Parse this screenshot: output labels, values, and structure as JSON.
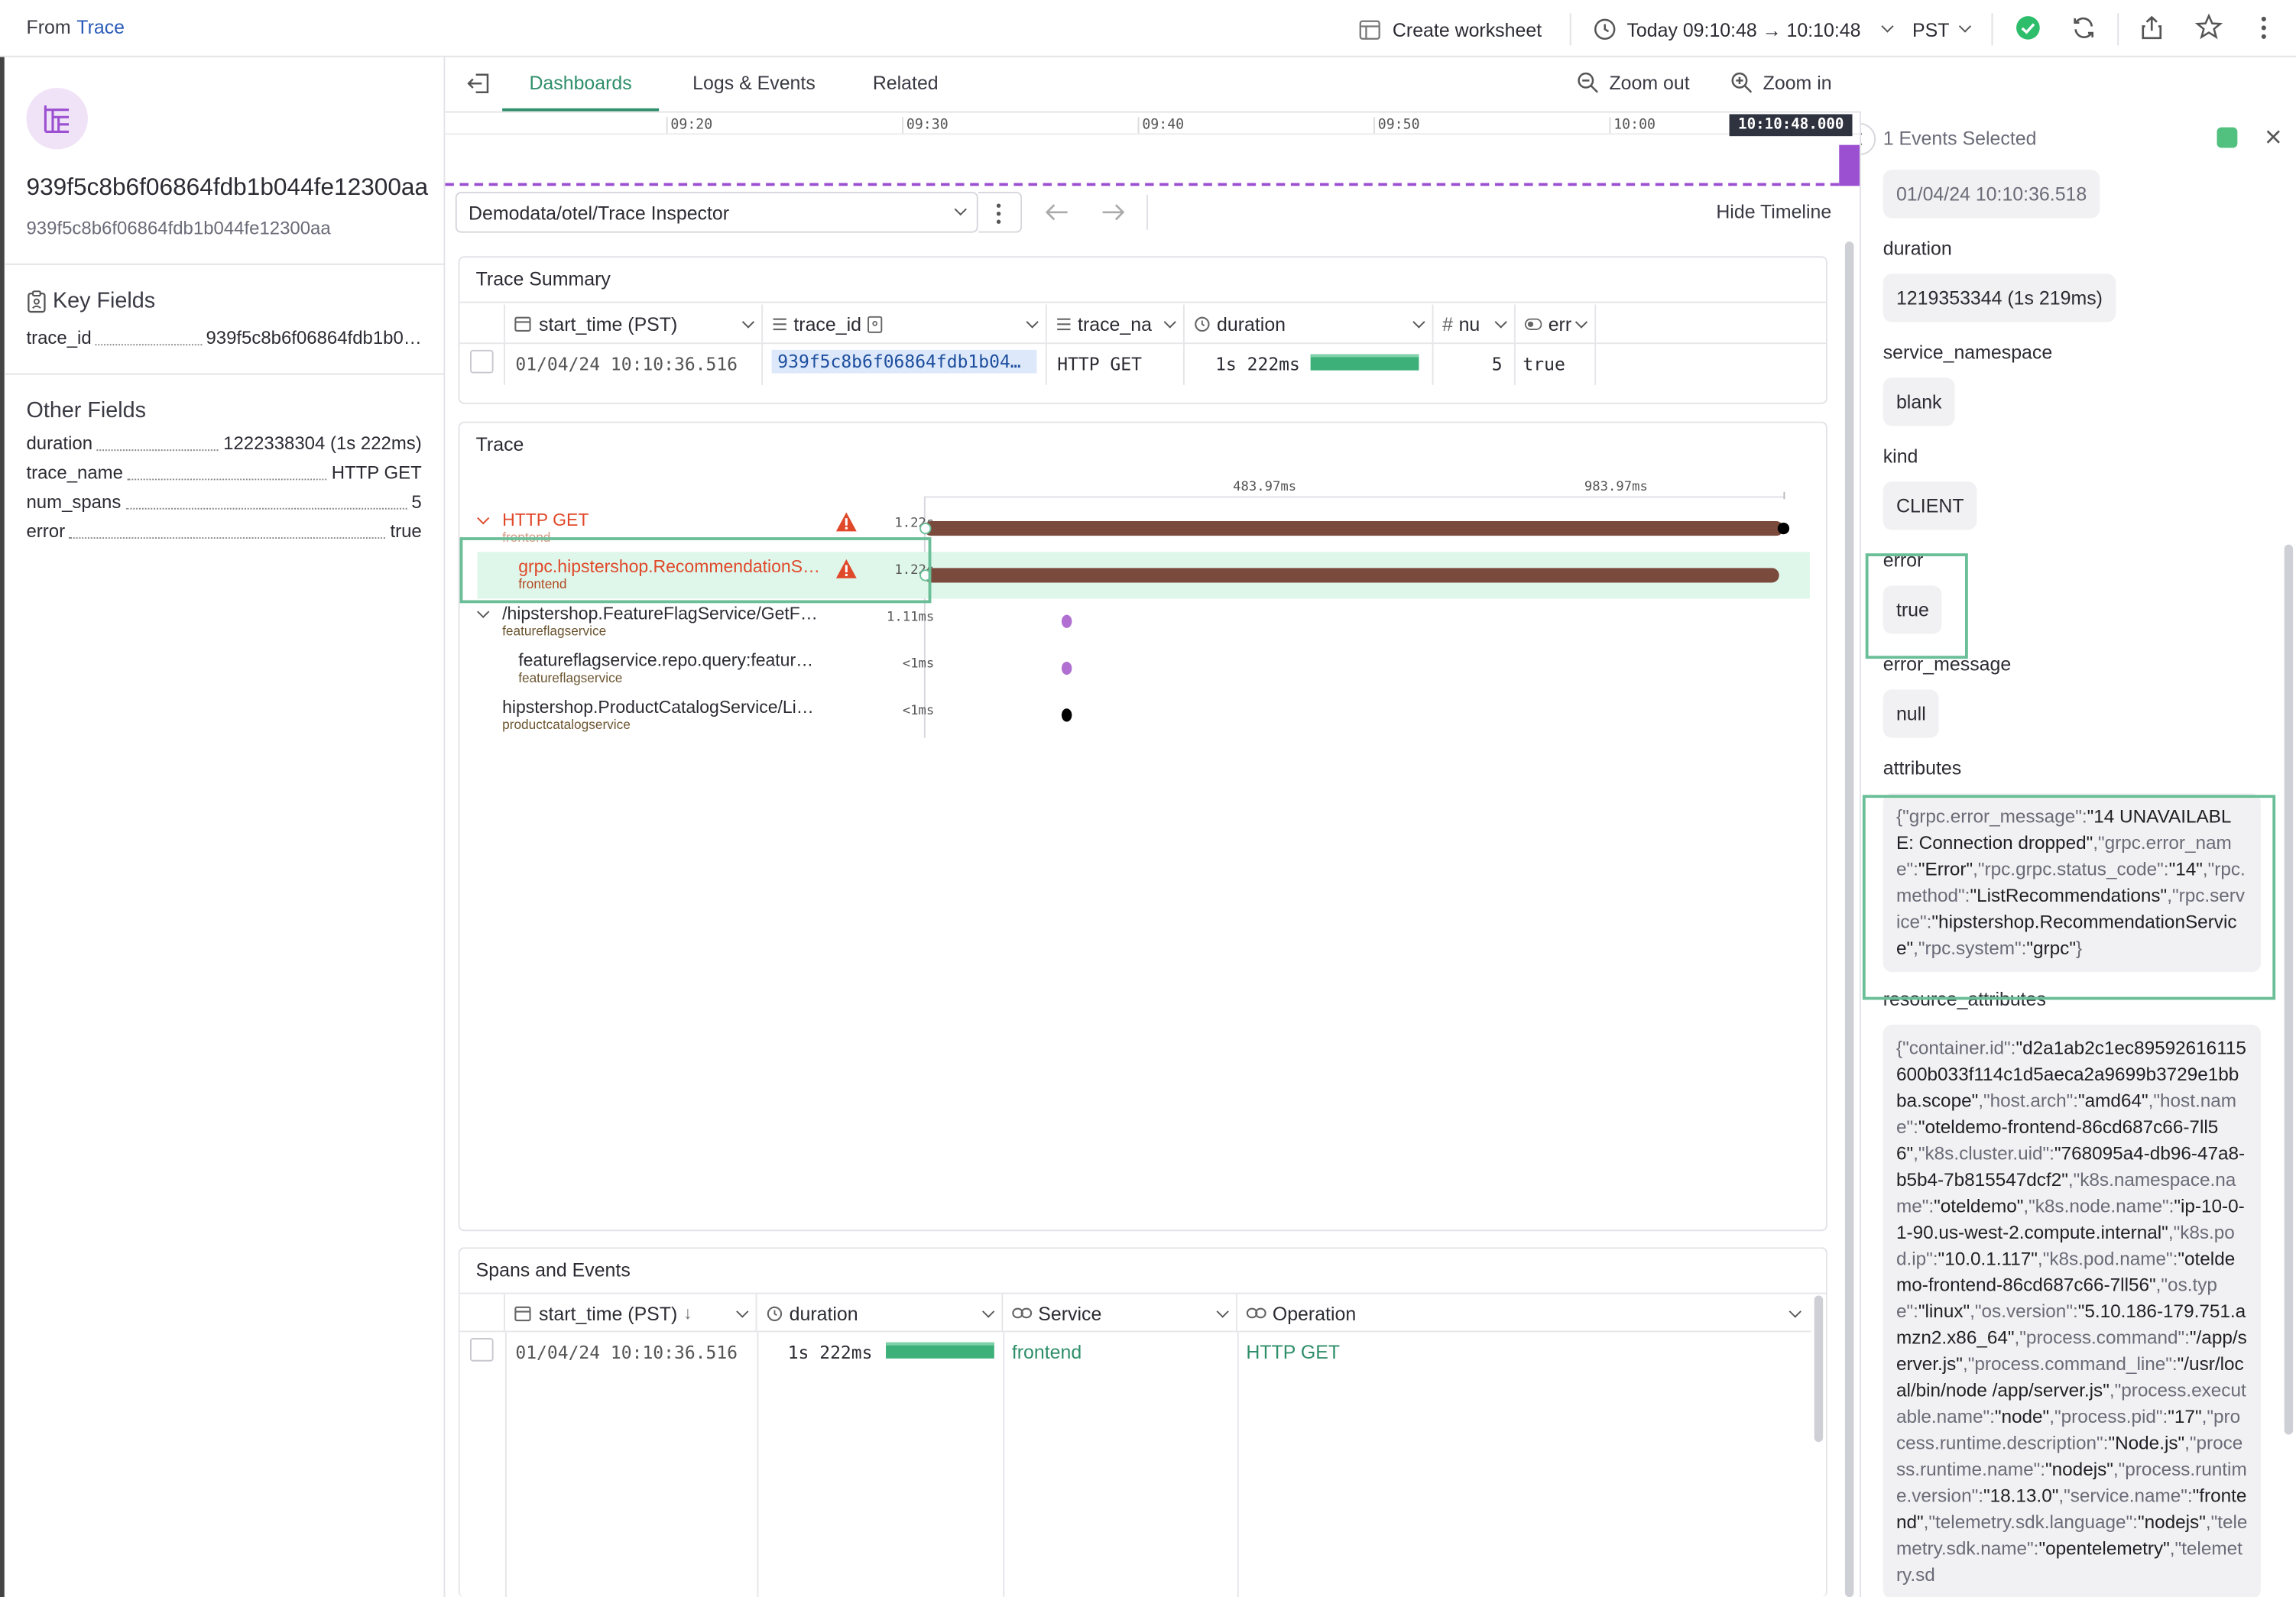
{
  "topbar": {
    "from_prefix": "From",
    "from_link": "Trace",
    "create_worksheet": "Create worksheet",
    "time_range": "Today 09:10:48 → 10:10:48",
    "timezone": "PST"
  },
  "left": {
    "trace_id_title": "939f5c8b6f06864fdb1b044fe12300aa",
    "trace_id_sub": "939f5c8b6f06864fdb1b044fe12300aa",
    "key_fields_title": "Key Fields",
    "key_fields": [
      {
        "key": "trace_id",
        "value": "939f5c8b6f06864fdb1b0…"
      }
    ],
    "other_fields_title": "Other Fields",
    "other_fields": [
      {
        "key": "duration",
        "value": "1222338304 (1s 222ms)"
      },
      {
        "key": "trace_name",
        "value": "HTTP GET"
      },
      {
        "key": "num_spans",
        "value": "5"
      },
      {
        "key": "error",
        "value": "true"
      }
    ]
  },
  "center": {
    "tabs": [
      "Dashboards",
      "Logs & Events",
      "Related"
    ],
    "zoom_out": "Zoom out",
    "zoom_in": "Zoom in",
    "timeline_ticks": [
      "09:20",
      "09:30",
      "09:40",
      "09:50",
      "10:00"
    ],
    "timeline_current": "10:10:48.000",
    "dashboard_select": "Demodata/otel/Trace Inspector",
    "hide_timeline": "Hide Timeline",
    "trace_summary": {
      "title": "Trace Summary",
      "columns": [
        "start_time (PST)",
        "trace_id",
        "trace_na",
        "duration",
        "nu",
        "err"
      ],
      "row": {
        "start_time": "01/04/24 10:10:36.516",
        "trace_id": "939f5c8b6f06864fdb1b04…",
        "trace_name": "HTTP GET",
        "duration": "1s 222ms",
        "num_spans": "5",
        "error": "true"
      },
      "duration_fill": 1.0
    },
    "trace": {
      "title": "Trace",
      "scale_labels": [
        "483.97ms",
        "983.97ms"
      ],
      "spans": [
        {
          "name": "HTTP GET",
          "service": "frontend",
          "duration": "1.22s",
          "error": true,
          "start": 0.0,
          "end": 1.0
        },
        {
          "name": "grpc.hipstershop.RecommendationS…",
          "service": "frontend",
          "duration": "1.22s",
          "error": true,
          "start": 0.0,
          "end": 0.995
        },
        {
          "name": "/hipstershop.FeatureFlagService/GetF…",
          "service": "featureflagservice",
          "duration": "1.11ms",
          "error": false,
          "start": 0.16,
          "end": 0.161
        },
        {
          "name": "featureflagservice.repo.query:featur…",
          "service": "featureflagservice",
          "duration": "<1ms",
          "error": false,
          "start": 0.16,
          "end": 0.161
        },
        {
          "name": "hipstershop.ProductCatalogService/Li…",
          "service": "productcatalogservice",
          "duration": "<1ms",
          "error": false,
          "start": 0.16,
          "end": 0.161
        }
      ]
    },
    "spans_events": {
      "title": "Spans and Events",
      "columns": [
        "start_time (PST)",
        "duration",
        "Service",
        "Operation"
      ],
      "row": {
        "start_time": "01/04/24 10:10:36.516",
        "duration": "1s 222ms",
        "service": "frontend",
        "operation": "HTTP GET"
      }
    }
  },
  "right": {
    "header": "1 Events Selected",
    "timestamp": "01/04/24 10:10:36.518",
    "fields": [
      {
        "name": "duration",
        "value": "1219353344 (1s 219ms)"
      },
      {
        "name": "service_namespace",
        "value": "blank"
      },
      {
        "name": "kind",
        "value": "CLIENT"
      },
      {
        "name": "error",
        "value": "true"
      },
      {
        "name": "error_message",
        "value": "null"
      }
    ],
    "attributes_label": "attributes",
    "attributes": [
      {
        "k": "\"grpc.error_message\"",
        "v": "\"14 UNAVAILABLE: Connection dropped\""
      },
      {
        "k": "\"grpc.error_name\"",
        "v": "\"Error\""
      },
      {
        "k": "\"rpc.grpc.status_code\"",
        "v": "\"14\""
      },
      {
        "k": "\"rpc.method\"",
        "v": "\"ListRecommendations\""
      },
      {
        "k": "\"rpc.service\"",
        "v": "\"hipstershop.RecommendationService\""
      },
      {
        "k": "\"rpc.system\"",
        "v": "\"grpc\""
      }
    ],
    "resource_label": "resource_attributes",
    "resource_attributes": [
      {
        "k": "\"container.id\"",
        "v": "\"d2a1ab2c1ec89592616115600b033f114c1d5aeca2a9699b3729e1bbba.scope\""
      },
      {
        "k": "\"host.arch\"",
        "v": "\"amd64\""
      },
      {
        "k": "\"host.name\"",
        "v": "\"oteldemo-frontend-86cd687c66-7ll56\""
      },
      {
        "k": "\"k8s.cluster.uid\"",
        "v": "\"768095a4-db96-47a8-b5b4-7b815547dcf2\""
      },
      {
        "k": "\"k8s.namespace.name\"",
        "v": "\"oteldemo\""
      },
      {
        "k": "\"k8s.node.name\"",
        "v": "\"ip-10-0-1-90.us-west-2.compute.internal\""
      },
      {
        "k": "\"k8s.pod.ip\"",
        "v": "\"10.0.1.117\""
      },
      {
        "k": "\"k8s.pod.name\"",
        "v": "\"oteldemo-frontend-86cd687c66-7ll56\""
      },
      {
        "k": "\"os.type\"",
        "v": "\"linux\""
      },
      {
        "k": "\"os.version\"",
        "v": "\"5.10.186-179.751.amzn2.x86_64\""
      },
      {
        "k": "\"process.command\"",
        "v": "\"/app/server.js\""
      },
      {
        "k": "\"process.command_line\"",
        "v": "\"/usr/local/bin/node /app/server.js\""
      },
      {
        "k": "\"process.executable.name\"",
        "v": "\"node\""
      },
      {
        "k": "\"process.pid\"",
        "v": "\"17\""
      },
      {
        "k": "\"process.runtime.description\"",
        "v": "\"Node.js\""
      },
      {
        "k": "\"process.runtime.name\"",
        "v": "\"nodejs\""
      },
      {
        "k": "\"process.runtime.version\"",
        "v": "\"18.13.0\""
      },
      {
        "k": "\"service.name\"",
        "v": "\"frontend\""
      },
      {
        "k": "\"telemetry.sdk.language\"",
        "v": "\"nodejs\""
      },
      {
        "k": "\"telemetry.sdk.name\"",
        "v": "\"opentelemetry\""
      },
      {
        "k": "\"telemetry.sd",
        "v": ""
      }
    ]
  },
  "colors": {
    "accent_green": "#2f8f6a",
    "error_red": "#e0482a",
    "span_bar": "#7a4a3c",
    "highlight_row": "#dff7ea",
    "purple": "#9b4fd1"
  }
}
